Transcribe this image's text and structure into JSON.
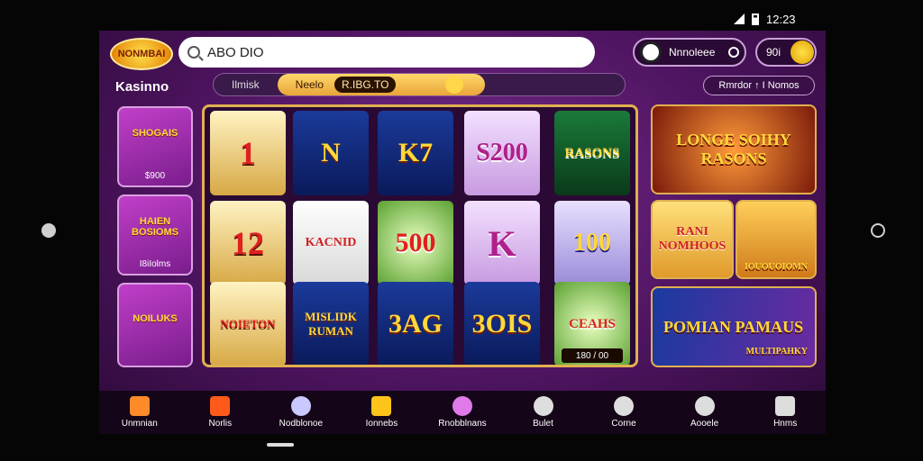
{
  "status": {
    "time": "12:23"
  },
  "app": {
    "logo_text": "NONMBAI",
    "brand": "Kasinno",
    "search_value": "ABO DIO",
    "user_label": "Nnnoleee",
    "coin_balance": "90i"
  },
  "tabs": [
    {
      "label": "Ilmisk"
    },
    {
      "label": "Neelo",
      "value": "R.IBG.TO"
    }
  ],
  "filter_label": "Rmrdor ↑ I Nomos",
  "side_tiles": [
    {
      "title": "SHOGAIS",
      "subtitle": "$900"
    },
    {
      "title": "HAIEN BOSIOMS",
      "subtitle": "I8iIolms"
    },
    {
      "title": "NOILUKS",
      "subtitle": ""
    }
  ],
  "reels": [
    [
      "1",
      "12",
      "NOIETON"
    ],
    [
      "N",
      "KACNID",
      "MISLIDK RUMAN"
    ],
    [
      "K7",
      "500",
      "3AG"
    ],
    [
      "S200",
      "K",
      "3OIS"
    ],
    [
      "RASONS",
      "100",
      "CEAHS"
    ]
  ],
  "reel_tile_bottom": "180 / 00",
  "right_tiles": [
    {
      "title": "LONGE SOIHY RASONS"
    },
    {
      "title": "RANI NOMHOOS"
    },
    {
      "title": "IOUOUOIOMN"
    },
    {
      "title": "POMIAN PAMAUS"
    },
    {
      "title": "MULTIPAHKY"
    }
  ],
  "nav": [
    {
      "label": "Unmnian",
      "icon": "home-icon",
      "color": "#ff8a2a"
    },
    {
      "label": "Norlis",
      "icon": "flame-icon",
      "color": "#ff5a1a"
    },
    {
      "label": "Nodblonoe",
      "icon": "controller-icon",
      "color": "#c9c9ff"
    },
    {
      "label": "Ionnebs",
      "icon": "pause-icon",
      "color": "#ffc41a"
    },
    {
      "label": "Rnobblnans",
      "icon": "record-icon",
      "color": "#e07ae8"
    },
    {
      "label": "Bulet",
      "icon": "target-icon",
      "color": "#dddddd"
    },
    {
      "label": "Corne",
      "icon": "gear-icon",
      "color": "#dddddd"
    },
    {
      "label": "Aooele",
      "icon": "search-icon",
      "color": "#dddddd"
    },
    {
      "label": "Hnms",
      "icon": "house-icon",
      "color": "#dddddd"
    }
  ]
}
